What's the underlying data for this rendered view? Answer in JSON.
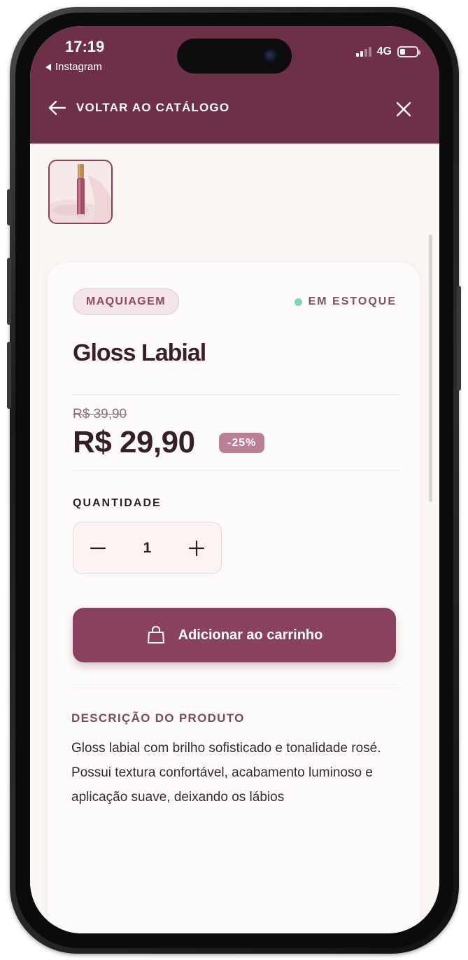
{
  "status_bar": {
    "time": "17:19",
    "back_app": "Instagram",
    "network": "4G"
  },
  "nav": {
    "back_label": "VOLTAR AO CATÁLOGO",
    "icons": [
      "arrow-left-icon",
      "close-icon"
    ]
  },
  "product": {
    "category": "MAQUIAGEM",
    "stock_status": "EM ESTOQUE",
    "title": "Gloss Labial",
    "price_old": "R$ 39,90",
    "price_new": "R$ 29,90",
    "discount": "-25%"
  },
  "quantity": {
    "label": "QUANTIDADE",
    "value": "1"
  },
  "cart_button": {
    "label": "Adicionar ao carrinho",
    "icon": "shopping-bag-icon"
  },
  "description": {
    "title": "DESCRIÇÃO DO PRODUTO",
    "text": "Gloss labial com brilho sofisticado e tonalidade rosé. Possui textura confortável, acabamento luminoso e aplicação suave, deixando os lábios"
  },
  "colors": {
    "brand": "#6e3049",
    "button": "#8a4160",
    "stock_dot": "#7fd6b0",
    "discount_badge": "#b87f97"
  }
}
